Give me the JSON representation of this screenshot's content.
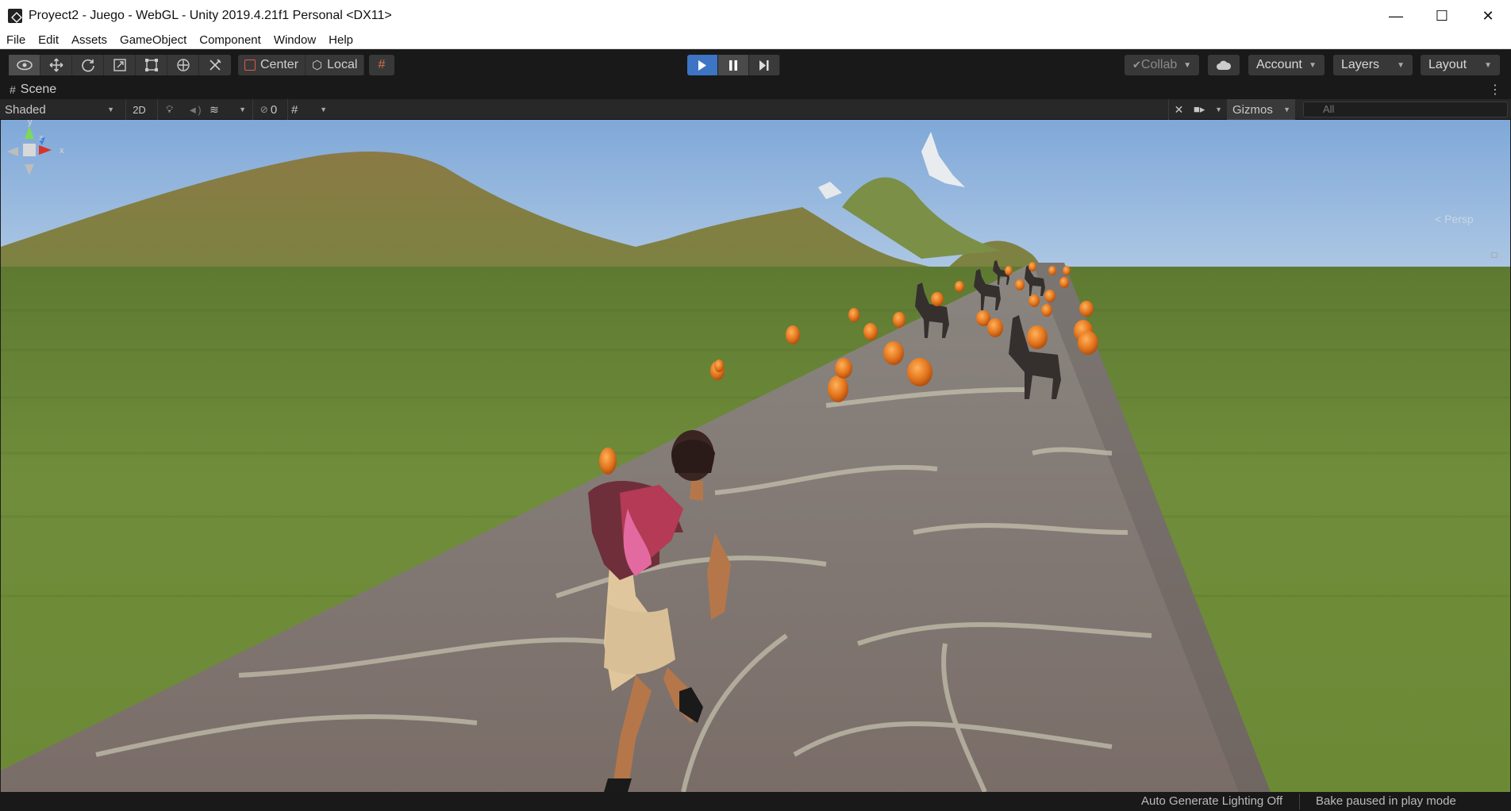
{
  "window": {
    "title": "Proyect2 - Juego - WebGL - Unity 2019.4.21f1 Personal <DX11>",
    "controls": {
      "minimize": "—",
      "maximize": "☐",
      "close": "✕"
    }
  },
  "menu": [
    "File",
    "Edit",
    "Assets",
    "GameObject",
    "Component",
    "Window",
    "Help"
  ],
  "toolbar": {
    "tools": [
      "view-tool-icon",
      "move-tool-icon",
      "rotate-tool-icon",
      "scale-tool-icon",
      "rect-tool-icon",
      "transform-tool-icon",
      "custom-tool-icon"
    ],
    "pivot_label": "Center",
    "space_label": "Local",
    "collab_label": "Collab",
    "account_label": "Account",
    "layers_label": "Layers",
    "layout_label": "Layout",
    "play_state": "playing",
    "pause_state": "active"
  },
  "scene": {
    "tab_label": "Scene",
    "shading_mode": "Shaded",
    "mode_2d": "2D",
    "hidden_count": "0",
    "gizmos_label": "Gizmos",
    "search_placeholder": "All",
    "persp_label": "< Persp",
    "gizmo_axes": {
      "y": "y",
      "z": "z",
      "x": "x"
    }
  },
  "status": {
    "lighting": "Auto Generate Lighting Off",
    "bake": "Bake paused in play mode"
  },
  "colors": {
    "play_active": "#3d74c4",
    "sky_top": "#8fb3dd",
    "grass": "#6f8a3a",
    "fruit": "#e07a1f"
  }
}
